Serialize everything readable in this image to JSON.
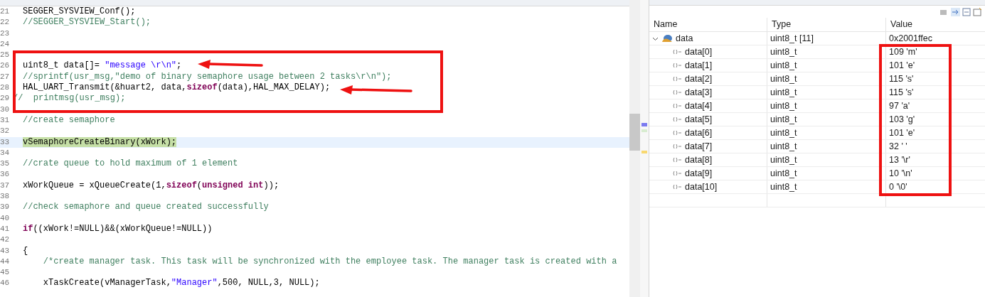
{
  "editor": {
    "lines": [
      {
        "number": "21",
        "kind": "code",
        "highlighted": false,
        "tokens": [
          {
            "kind": "plain",
            "text": "SEGGER_SYSVIEW_Conf();"
          }
        ]
      },
      {
        "number": "22",
        "kind": "code",
        "highlighted": false,
        "tokens": [
          {
            "kind": "comment",
            "text": "//SEGGER_SYSVIEW_Start();"
          }
        ]
      },
      {
        "number": "23",
        "kind": "code",
        "highlighted": false
      },
      {
        "number": "24",
        "kind": "code",
        "highlighted": false
      },
      {
        "number": "25",
        "kind": "code",
        "highlighted": false
      },
      {
        "number": "26",
        "kind": "code",
        "highlighted": false,
        "tokens": [
          {
            "kind": "plain",
            "text": "uint8_t data[]= "
          },
          {
            "kind": "string",
            "text": "\"message \\r\\n\""
          },
          {
            "kind": "plain",
            "text": ";"
          }
        ]
      },
      {
        "number": "27",
        "kind": "code",
        "highlighted": false,
        "tokens": [
          {
            "kind": "comment",
            "text": "//sprintf(usr_msg,\"demo of binary semaphore usage between 2 tasks\\r\\n\");"
          }
        ]
      },
      {
        "number": "28",
        "kind": "code",
        "highlighted": false,
        "tokens": [
          {
            "kind": "plain",
            "text": "HAL_UART_Transmit(&huart2, data,"
          },
          {
            "kind": "keyword",
            "text": "sizeof"
          },
          {
            "kind": "plain",
            "text": "(data),HAL_MAX_DELAY);"
          }
        ]
      },
      {
        "number": "29",
        "kind": "gutter_comment",
        "highlighted": false,
        "tokens": [
          {
            "kind": "comment",
            "text": "//  printmsg(usr_msg);"
          }
        ]
      },
      {
        "number": "30",
        "kind": "code",
        "highlighted": false
      },
      {
        "number": "31",
        "kind": "code",
        "highlighted": false,
        "tokens": [
          {
            "kind": "comment",
            "text": "//create semaphore"
          }
        ]
      },
      {
        "number": "32",
        "kind": "code",
        "highlighted": false
      },
      {
        "number": "33",
        "kind": "code",
        "highlighted": true,
        "tokens": [
          {
            "kind": "plain",
            "text": "vSemaphoreCreateBinary(xWork);"
          }
        ]
      },
      {
        "number": "34",
        "kind": "code",
        "highlighted": false
      },
      {
        "number": "35",
        "kind": "code",
        "highlighted": false,
        "tokens": [
          {
            "kind": "comment",
            "text": "//crate queue to hold maximum of 1 element"
          }
        ]
      },
      {
        "number": "36",
        "kind": "code",
        "highlighted": false
      },
      {
        "number": "37",
        "kind": "code",
        "highlighted": false,
        "tokens": [
          {
            "kind": "plain",
            "text": "xWorkQueue = xQueueCreate(1,"
          },
          {
            "kind": "keyword",
            "text": "sizeof"
          },
          {
            "kind": "plain",
            "text": "("
          },
          {
            "kind": "keyword",
            "text": "unsigned int"
          },
          {
            "kind": "plain",
            "text": "));"
          }
        ]
      },
      {
        "number": "38",
        "kind": "code",
        "highlighted": false
      },
      {
        "number": "39",
        "kind": "code",
        "highlighted": false,
        "tokens": [
          {
            "kind": "comment",
            "text": "//check semaphore and queue created successfully"
          }
        ]
      },
      {
        "number": "40",
        "kind": "code",
        "highlighted": false
      },
      {
        "number": "41",
        "kind": "code",
        "highlighted": false,
        "tokens": [
          {
            "kind": "keyword",
            "text": "if"
          },
          {
            "kind": "plain",
            "text": "((xWork!=NULL)&&(xWorkQueue!=NULL))"
          }
        ]
      },
      {
        "number": "42",
        "kind": "code",
        "highlighted": false
      },
      {
        "number": "43",
        "kind": "code",
        "highlighted": false,
        "tokens": [
          {
            "kind": "plain",
            "text": "{"
          }
        ]
      },
      {
        "number": "44",
        "kind": "code",
        "highlighted": false,
        "tokens": [
          {
            "kind": "comment",
            "text": "    /*create manager task. This task will be synchronized with the employee task. The manager task is created with a"
          }
        ]
      },
      {
        "number": "45",
        "kind": "code",
        "highlighted": false
      },
      {
        "number": "46",
        "kind": "code",
        "highlighted": false,
        "tokens": [
          {
            "kind": "plain",
            "text": "    xTaskCreate(vManagerTask,"
          },
          {
            "kind": "string",
            "text": "\"Manager\""
          },
          {
            "kind": "plain",
            "text": ",500, NULL,3, NULL);"
          }
        ]
      }
    ]
  },
  "variables": {
    "columns": [
      "Name",
      "Type",
      "Value"
    ],
    "rows": [
      {
        "name": "data",
        "type": "uint8_t [11]",
        "value": "0x2001ffec",
        "expanded": true,
        "children": [
          {
            "name": "data[0]",
            "type": "uint8_t",
            "value": "109 'm'"
          },
          {
            "name": "data[1]",
            "type": "uint8_t",
            "value": "101 'e'"
          },
          {
            "name": "data[2]",
            "type": "uint8_t",
            "value": "115 's'"
          },
          {
            "name": "data[3]",
            "type": "uint8_t",
            "value": "115 's'"
          },
          {
            "name": "data[4]",
            "type": "uint8_t",
            "value": "97 'a'"
          },
          {
            "name": "data[5]",
            "type": "uint8_t",
            "value": "103 'g'"
          },
          {
            "name": "data[6]",
            "type": "uint8_t",
            "value": "101 'e'"
          },
          {
            "name": "data[7]",
            "type": "uint8_t",
            "value": "32 ' '"
          },
          {
            "name": "data[8]",
            "type": "uint8_t",
            "value": "13 '\\r'"
          },
          {
            "name": "data[9]",
            "type": "uint8_t",
            "value": "10 '\\n'"
          },
          {
            "name": "data[10]",
            "type": "uint8_t",
            "value": "0 '\\0'"
          }
        ]
      }
    ]
  }
}
